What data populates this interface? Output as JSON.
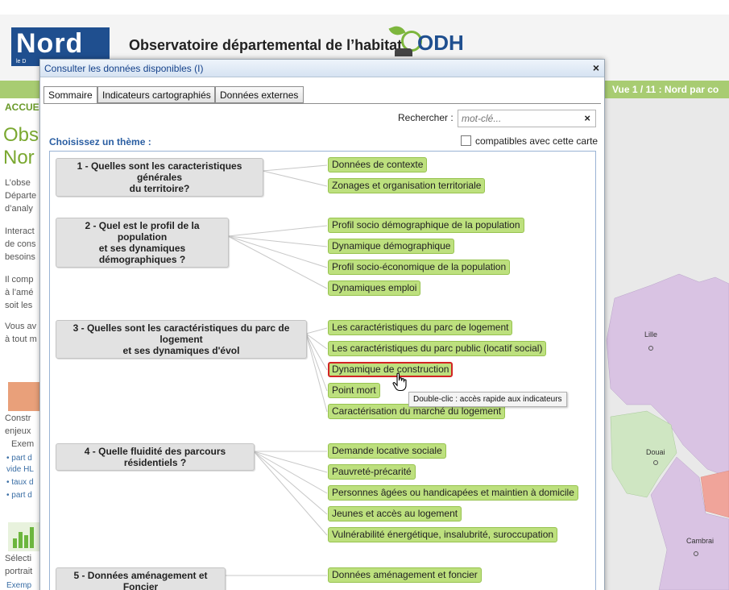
{
  "site": {
    "logo_text": "Nord",
    "logo_subtext": "le D",
    "title": "Observatoire départemental de l’habitat",
    "odh_logo_text": "ODH",
    "vue_label": "Vue 1 / 11 : Nord par co"
  },
  "left_column": {
    "accueil": "ACCUE",
    "heading_line1": "Obs",
    "heading_line2": "Nor",
    "paragraph1": [
      "L’obse",
      "Départe",
      "d’analy"
    ],
    "paragraph2": [
      "Interact",
      "de cons",
      "besoins"
    ],
    "paragraph3": [
      "Il comp",
      "à l’amé",
      "soit les"
    ],
    "paragraph4": [
      "Vous av",
      "à tout m"
    ],
    "block1_text": [
      "Constr",
      "enjeux",
      "Exem"
    ],
    "block1_links": [
      "• part d",
      "vide HL",
      "• taux d",
      "• part d"
    ],
    "block2_text": [
      "Sélecti",
      "portrait",
      "Exemp"
    ]
  },
  "map": {
    "cities": [
      "Lille",
      "Douai",
      "Cambrai"
    ],
    "colors": {
      "purple": "#d9c3e3",
      "green": "#cfe6c2",
      "red": "#f0a49a",
      "grey": "#e9e9e9"
    }
  },
  "dialog": {
    "title": "Consulter les données disponibles (I)",
    "close_icon": "×",
    "tabs": [
      "Sommaire",
      "Indicateurs cartographiés",
      "Données externes"
    ],
    "search": {
      "label": "Rechercher :",
      "placeholder": "mot-clé...",
      "clear_icon": "×"
    },
    "choose_label": "Choisissez un thème :",
    "compat_label": "compatibles avec cette carte",
    "themes": [
      {
        "title_lines": [
          "1 - Quelles sont les caracteristiques générales",
          "du territoire?"
        ],
        "items": [
          "Données de contexte",
          "Zonages et organisation territoriale"
        ]
      },
      {
        "title_lines": [
          "2 - Quel est le profil de la population",
          "et ses dynamiques démographiques ?"
        ],
        "items": [
          "Profil socio démographique de la population",
          "Dynamique démographique",
          "Profil socio-économique de la population",
          "Dynamiques emploi"
        ]
      },
      {
        "title_lines": [
          "3 - Quelles sont les caractéristiques du parc de logement",
          "et ses dynamiques d'évol"
        ],
        "items": [
          "Les caractéristiques du parc de logement",
          "Les caractéristiques du parc public (locatif social)",
          "Dynamique de construction",
          "Point mort",
          "Caractérisation du marché du logement"
        ]
      },
      {
        "title_lines": [
          "4 - Quelle fluidité des parcours résidentiels ?"
        ],
        "items": [
          "Demande locative sociale",
          "Pauvreté-précarité",
          "Personnes âgées ou handicapées et maintien à domicile",
          "Jeunes et accès au logement",
          "Vulnérabilité énergétique, insalubrité, suroccupation"
        ]
      },
      {
        "title_lines": [
          "5 - Données aménagement et Foncier"
        ],
        "items": [
          "Données aménagement et foncier"
        ]
      }
    ],
    "selected_item": "Dynamique de construction",
    "tooltip": "Double-clic : accès rapide aux indicateurs"
  }
}
